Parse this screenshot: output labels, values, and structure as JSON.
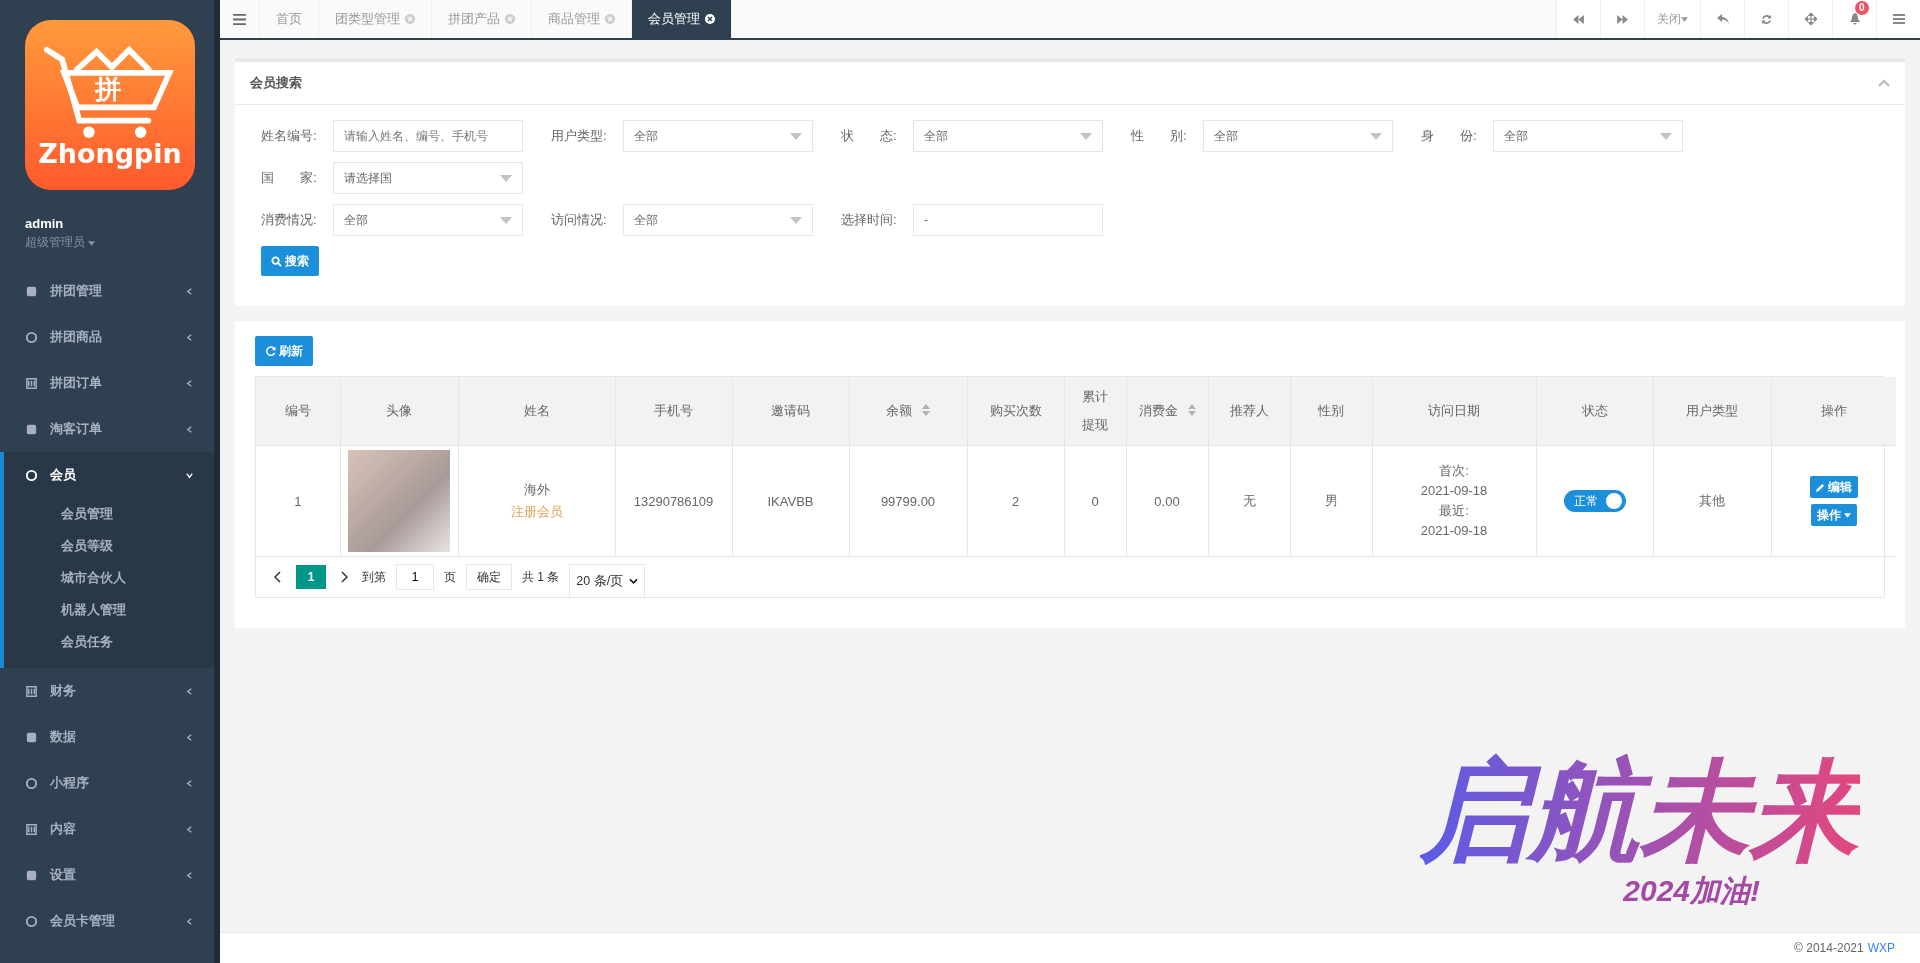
{
  "sidebar": {
    "logo": {
      "glyph": "拼",
      "name": "Zhongpin"
    },
    "user": {
      "name": "admin",
      "role": "超级管理员"
    },
    "items": [
      {
        "label": "拼团管理",
        "expanded": false
      },
      {
        "label": "拼团商品",
        "expanded": false
      },
      {
        "label": "拼团订单",
        "expanded": false
      },
      {
        "label": "淘客订单",
        "expanded": false
      },
      {
        "label": "会员",
        "expanded": true,
        "children": [
          {
            "label": "会员管理"
          },
          {
            "label": "会员等级"
          },
          {
            "label": "城市合伙人"
          },
          {
            "label": "机器人管理"
          },
          {
            "label": "会员任务"
          }
        ]
      },
      {
        "label": "财务",
        "expanded": false
      },
      {
        "label": "数据",
        "expanded": false
      },
      {
        "label": "小程序",
        "expanded": false
      },
      {
        "label": "内容",
        "expanded": false
      },
      {
        "label": "设置",
        "expanded": false
      },
      {
        "label": "会员卡管理",
        "expanded": false
      }
    ]
  },
  "tabs": [
    {
      "label": "首页",
      "closable": false,
      "selected": false
    },
    {
      "label": "团类型管理",
      "closable": true,
      "selected": false
    },
    {
      "label": "拼团产品",
      "closable": true,
      "selected": false
    },
    {
      "label": "商品管理",
      "closable": true,
      "selected": false
    },
    {
      "label": "会员管理",
      "closable": true,
      "selected": true
    }
  ],
  "toolbar": {
    "close_label": "关闭",
    "notification_count": "0"
  },
  "search_panel": {
    "title": "会员搜索",
    "search_button": "搜索",
    "rows": [
      [
        {
          "label": "姓名编号:",
          "kind": "input",
          "placeholder": "请输入姓名、编号、手机号"
        },
        {
          "label": "用户类型:",
          "kind": "select",
          "value": "全部"
        },
        {
          "label": "状　　态:",
          "kind": "select",
          "value": "全部"
        },
        {
          "label": "性　　别:",
          "kind": "select",
          "value": "全部"
        },
        {
          "label": "身　　份:",
          "kind": "select",
          "value": "全部"
        }
      ],
      [
        {
          "label": "国　　家:",
          "kind": "select",
          "value": "请选择国"
        }
      ],
      [
        {
          "label": "消费情况:",
          "kind": "select",
          "value": "全部"
        },
        {
          "label": "访问情况:",
          "kind": "select",
          "value": "全部"
        },
        {
          "label": "选择时间:",
          "kind": "input",
          "value": "-"
        }
      ]
    ]
  },
  "table_panel": {
    "refresh_button": "刷新",
    "columns": [
      {
        "label": "编号",
        "sortable": false
      },
      {
        "label": "头像",
        "sortable": false
      },
      {
        "label": "姓名",
        "sortable": false
      },
      {
        "label": "手机号",
        "sortable": false
      },
      {
        "label": "邀请码",
        "sortable": false
      },
      {
        "label": "余额",
        "sortable": true
      },
      {
        "label": "购买次数",
        "sortable": false
      },
      {
        "label": "累计提现",
        "sortable": false
      },
      {
        "label": "消费金",
        "sortable": true
      },
      {
        "label": "推荐人",
        "sortable": false
      },
      {
        "label": "性别",
        "sortable": false
      },
      {
        "label": "访问日期",
        "sortable": false
      },
      {
        "label": "状态",
        "sortable": false
      },
      {
        "label": "用户类型",
        "sortable": false
      },
      {
        "label": "操作",
        "sortable": false
      }
    ],
    "rows": [
      {
        "cells": [
          {
            "kind": "text",
            "text": "1"
          },
          {
            "kind": "avatar"
          },
          {
            "kind": "name",
            "text": "海外",
            "tag": "注册会员"
          },
          {
            "kind": "text",
            "text": "13290786109"
          },
          {
            "kind": "text",
            "text": "IKAVBB"
          },
          {
            "kind": "text",
            "text": "99799.00"
          },
          {
            "kind": "text",
            "text": "2"
          },
          {
            "kind": "text",
            "text": "0"
          },
          {
            "kind": "text",
            "text": "0.00"
          },
          {
            "kind": "text",
            "text": "无"
          },
          {
            "kind": "text",
            "text": "男"
          },
          {
            "kind": "visit",
            "first_label": "首次:",
            "first_date": "2021-09-18",
            "recent_label": "最近:",
            "recent_date": "2021-09-18"
          },
          {
            "kind": "status",
            "label": "正常",
            "on": true
          },
          {
            "kind": "text",
            "text": "其他"
          },
          {
            "kind": "actions",
            "edit": "编辑",
            "more": "操作"
          }
        ]
      }
    ],
    "pagination": {
      "pages": [
        {
          "label": "1",
          "selected": true
        }
      ],
      "goto_label": "到第",
      "goto_value": "1",
      "page_unit": "页",
      "confirm": "确定",
      "total": "共 1 条",
      "page_size": "20 条/页"
    }
  },
  "decoration": {
    "title": "启航未来",
    "subtitle": "2024加油!"
  },
  "footer": {
    "copyright": "© 2014-2021",
    "link": "WXP"
  }
}
